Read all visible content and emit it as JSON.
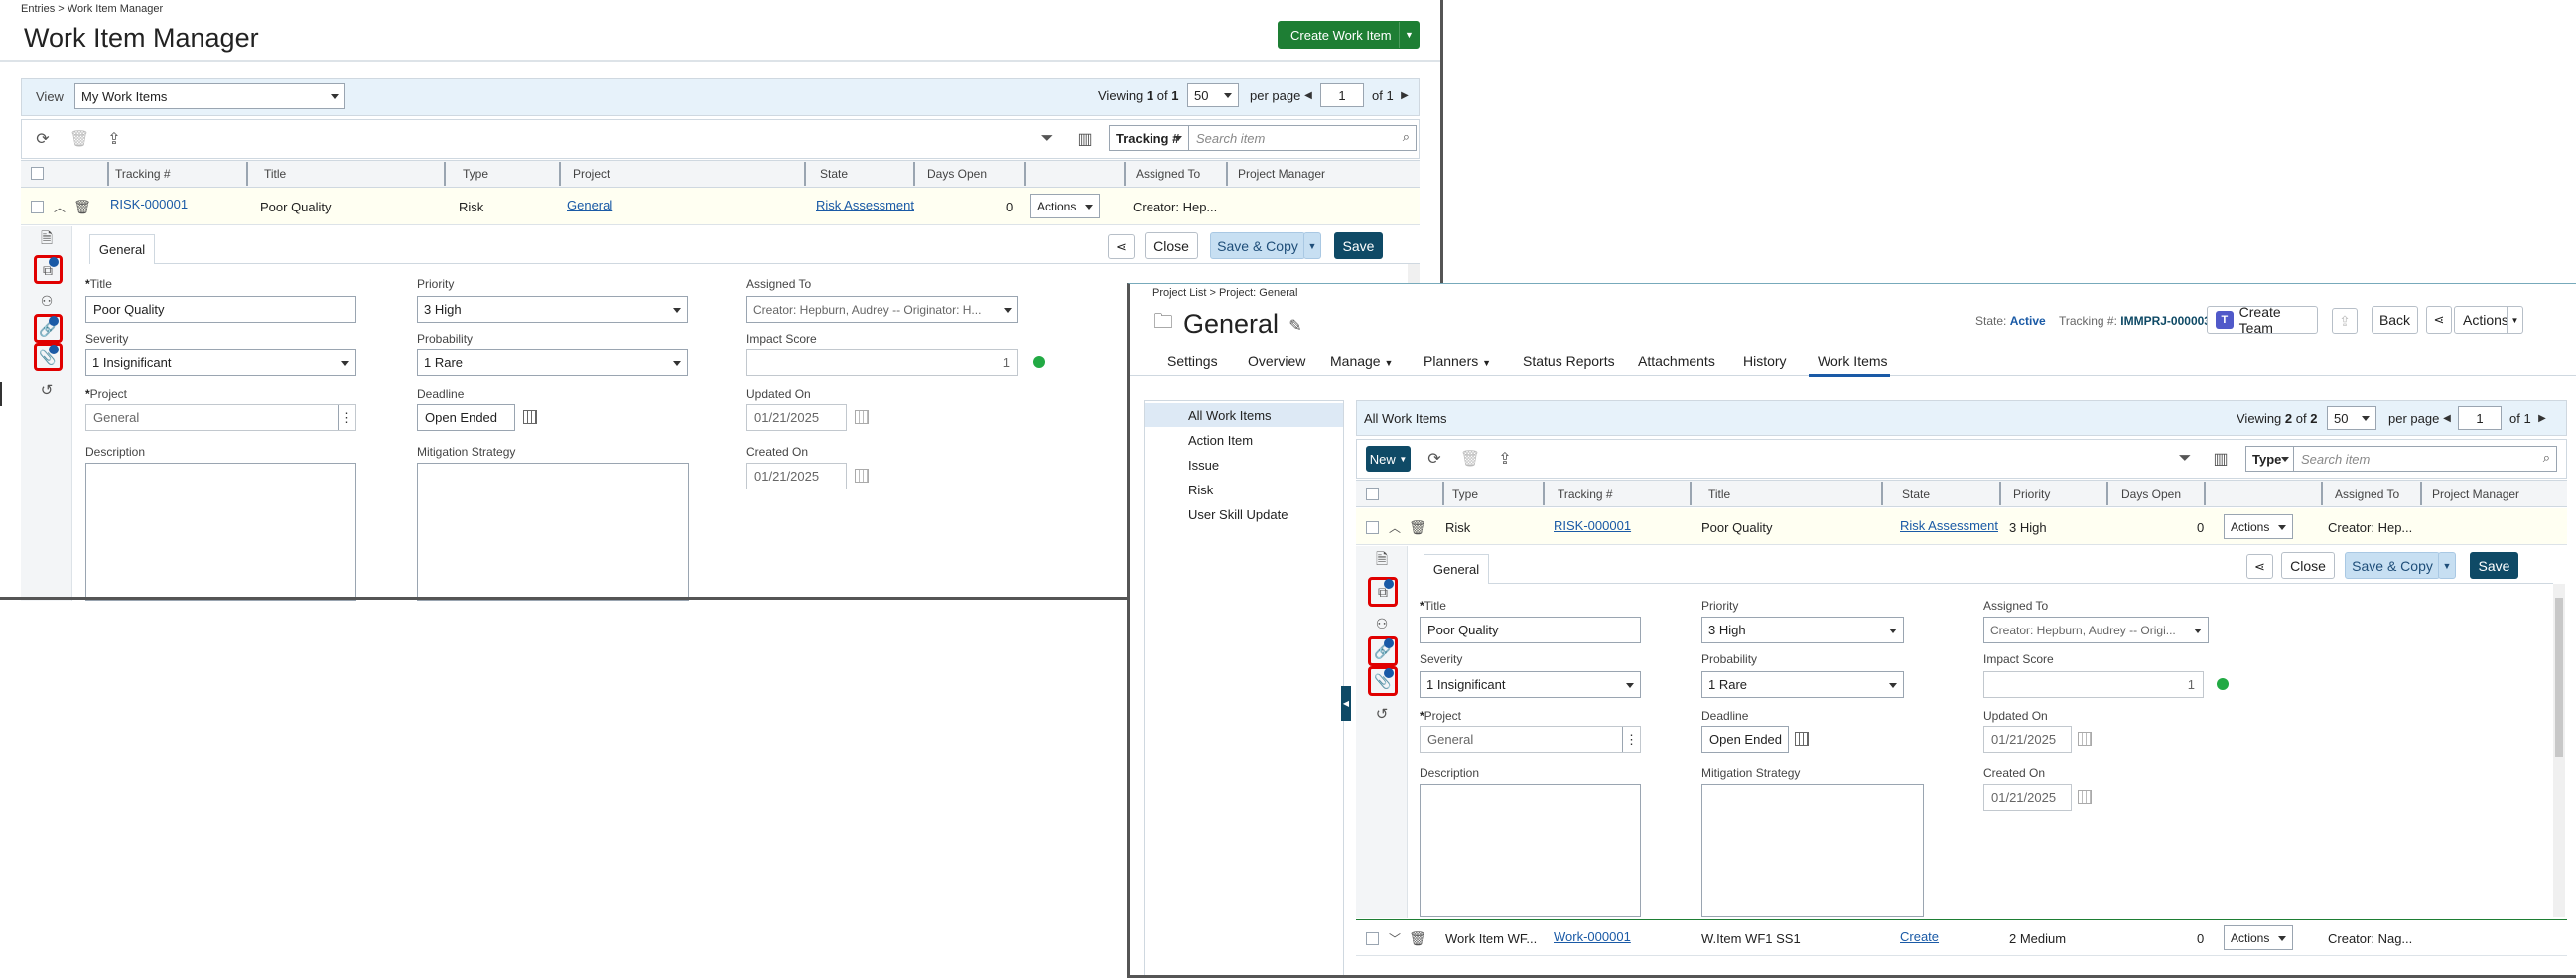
{
  "left": {
    "breadcrumb": "Entries > Work Item Manager",
    "title": "Work Item Manager",
    "create_button": "Create Work Item",
    "view_label": "View",
    "view_value": "My Work Items",
    "viewing_prefix": "Viewing",
    "viewing_current": "1",
    "viewing_of": "of",
    "viewing_total": "1",
    "per_page_value": "50",
    "per_page_label": "per page",
    "page_value": "1",
    "page_of": "of 1",
    "search_field": "Tracking #",
    "search_placeholder": "Search item",
    "columns": [
      "Tracking #",
      "Title",
      "Type",
      "Project",
      "State",
      "Days Open",
      "",
      "Assigned To",
      "Project Manager"
    ],
    "row": {
      "tracking": "RISK-000001",
      "title": "Poor Quality",
      "type": "Risk",
      "project": "General",
      "state": "Risk Assessment",
      "days_open": "0",
      "actions": "Actions",
      "assigned": "Creator: Hep..."
    },
    "detail_tab": "General",
    "close_label": "Close",
    "save_copy_label": "Save & Copy",
    "save_label": "Save",
    "form": {
      "title_label": "Title",
      "title_value": "Poor Quality",
      "priority_label": "Priority",
      "priority_value": "3 High",
      "assigned_label": "Assigned To",
      "assigned_value": "Creator: Hepburn, Audrey -- Originator: H...",
      "severity_label": "Severity",
      "severity_value": "1 Insignificant",
      "probability_label": "Probability",
      "probability_value": "1 Rare",
      "impact_label": "Impact Score",
      "impact_value": "1",
      "project_label": "Project",
      "project_value": "General",
      "deadline_label": "Deadline",
      "deadline_value": "Open Ended",
      "updated_label": "Updated On",
      "updated_value": "01/21/2025",
      "description_label": "Description",
      "mitigation_label": "Mitigation Strategy",
      "created_label": "Created On",
      "created_value": "01/21/2025"
    }
  },
  "right": {
    "breadcrumb": "Project List > Project: General",
    "title": "General",
    "state_label": "State:",
    "state_value": "Active",
    "tracking_label": "Tracking #:",
    "tracking_value": "IMMPRJ-000003",
    "create_team": "Create Team",
    "back_label": "Back",
    "actions_label": "Actions",
    "tabs": [
      "Settings",
      "Overview",
      "Manage",
      "Planners",
      "Status Reports",
      "Attachments",
      "History",
      "Work Items"
    ],
    "nav": [
      "All Work Items",
      "Action Item",
      "Issue",
      "Risk",
      "User Skill Update"
    ],
    "list_title": "All Work Items",
    "viewing_prefix": "Viewing",
    "viewing_current": "2",
    "viewing_of": "of",
    "viewing_total": "2",
    "per_page_value": "50",
    "per_page_label": "per page",
    "page_value": "1",
    "page_of": "of 1",
    "new_label": "New",
    "search_field": "Type",
    "search_placeholder": "Search item",
    "columns": [
      "Type",
      "Tracking #",
      "Title",
      "State",
      "Priority",
      "Days Open",
      "",
      "Assigned To",
      "Project Manager"
    ],
    "row1": {
      "type": "Risk",
      "tracking": "RISK-000001",
      "title": "Poor Quality",
      "state": "Risk Assessment",
      "priority": "3 High",
      "days_open": "0",
      "actions": "Actions",
      "assigned": "Creator: Hep..."
    },
    "row2": {
      "type": "Work Item WF...",
      "tracking": "Work-000001",
      "title": "W.Item WF1 SS1",
      "state": "Create",
      "priority": "2 Medium",
      "days_open": "0",
      "actions": "Actions",
      "assigned": "Creator: Nag..."
    },
    "detail_tab": "General",
    "close_label": "Close",
    "save_copy_label": "Save & Copy",
    "save_label": "Save",
    "form": {
      "title_label": "Title",
      "title_value": "Poor Quality",
      "priority_label": "Priority",
      "priority_value": "3 High",
      "assigned_label": "Assigned To",
      "assigned_value": "Creator: Hepburn, Audrey -- Origi...",
      "severity_label": "Severity",
      "severity_value": "1 Insignificant",
      "probability_label": "Probability",
      "probability_value": "1 Rare",
      "impact_label": "Impact Score",
      "impact_value": "1",
      "project_label": "Project",
      "project_value": "General",
      "deadline_label": "Deadline",
      "deadline_value": "Open Ended",
      "updated_label": "Updated On",
      "updated_value": "01/21/2025",
      "description_label": "Description",
      "mitigation_label": "Mitigation Strategy",
      "created_label": "Created On",
      "created_value": "01/21/2025"
    }
  },
  "side_icons": [
    "document-icon",
    "linked-items-icon",
    "users-icon",
    "link-icon",
    "attachment-icon",
    "history-icon"
  ],
  "colors": {
    "accent": "#1e7e34",
    "navy": "#0f4a66",
    "highlight": "#e00000",
    "link": "#1a5aa6"
  }
}
